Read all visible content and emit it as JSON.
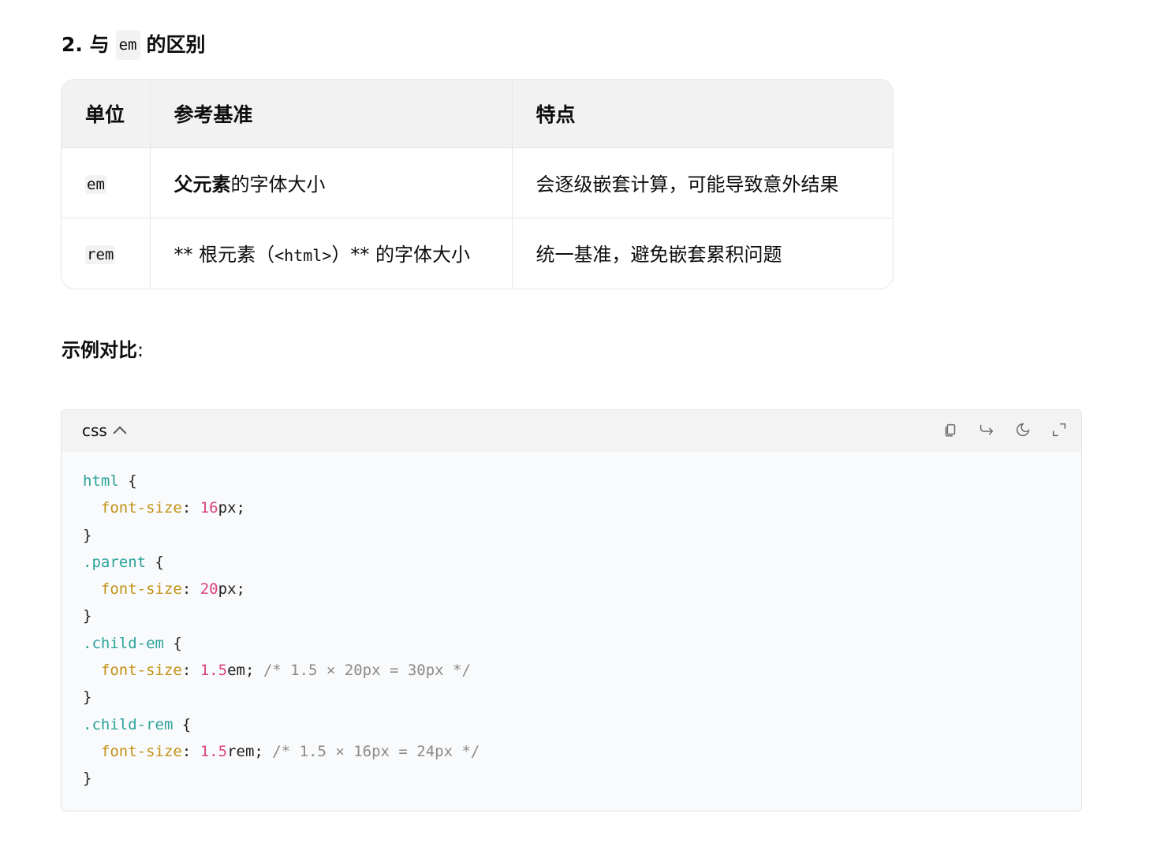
{
  "heading": {
    "prefix": "2. 与",
    "code": "em",
    "suffix": "的区别"
  },
  "table": {
    "headers": [
      "单位",
      "参考基准",
      "特点"
    ],
    "rows": [
      {
        "unit": "em",
        "basis_bold": "父元素",
        "basis_rest": "的字体大小",
        "feature": "会逐级嵌套计算，可能导致意外结果"
      },
      {
        "unit": "rem",
        "basis_pre": "** 根元素（",
        "basis_code": "<html>",
        "basis_post": "）** 的字体大小",
        "feature": "统一基准，避免嵌套累积问题"
      }
    ]
  },
  "example_label": {
    "bold": "示例对比",
    "colon": ":"
  },
  "code_block": {
    "language": "css",
    "icons": [
      "copy-icon",
      "share-icon",
      "theme-moon-icon",
      "expand-icon"
    ],
    "lines": [
      [
        {
          "t": "sel",
          "v": "html"
        },
        {
          "t": "pun",
          "v": " {"
        }
      ],
      [
        {
          "t": "pun",
          "v": "  "
        },
        {
          "t": "prop",
          "v": "font-size"
        },
        {
          "t": "pun",
          "v": ": "
        },
        {
          "t": "num",
          "v": "16"
        },
        {
          "t": "pun",
          "v": "px;"
        }
      ],
      [
        {
          "t": "pun",
          "v": "}"
        }
      ],
      [
        {
          "t": "sel",
          "v": ".parent"
        },
        {
          "t": "pun",
          "v": " {"
        }
      ],
      [
        {
          "t": "pun",
          "v": "  "
        },
        {
          "t": "prop",
          "v": "font-size"
        },
        {
          "t": "pun",
          "v": ": "
        },
        {
          "t": "num",
          "v": "20"
        },
        {
          "t": "pun",
          "v": "px;"
        }
      ],
      [
        {
          "t": "pun",
          "v": "}"
        }
      ],
      [
        {
          "t": "sel",
          "v": ".child-em"
        },
        {
          "t": "pun",
          "v": " {"
        }
      ],
      [
        {
          "t": "pun",
          "v": "  "
        },
        {
          "t": "prop",
          "v": "font-size"
        },
        {
          "t": "pun",
          "v": ": "
        },
        {
          "t": "num",
          "v": "1.5"
        },
        {
          "t": "pun",
          "v": "em; "
        },
        {
          "t": "cmt",
          "v": "/* 1.5 × 20px = 30px */"
        }
      ],
      [
        {
          "t": "pun",
          "v": "}"
        }
      ],
      [
        {
          "t": "sel",
          "v": ".child-rem"
        },
        {
          "t": "pun",
          "v": " {"
        }
      ],
      [
        {
          "t": "pun",
          "v": "  "
        },
        {
          "t": "prop",
          "v": "font-size"
        },
        {
          "t": "pun",
          "v": ": "
        },
        {
          "t": "num",
          "v": "1.5"
        },
        {
          "t": "pun",
          "v": "rem; "
        },
        {
          "t": "cmt",
          "v": "/* 1.5 × 16px = 24px */"
        }
      ],
      [
        {
          "t": "pun",
          "v": "}"
        }
      ]
    ]
  },
  "colors": {
    "selector": "#2ba39a",
    "property": "#c29217",
    "number": "#d8437f",
    "comment": "#8a8a8a"
  }
}
